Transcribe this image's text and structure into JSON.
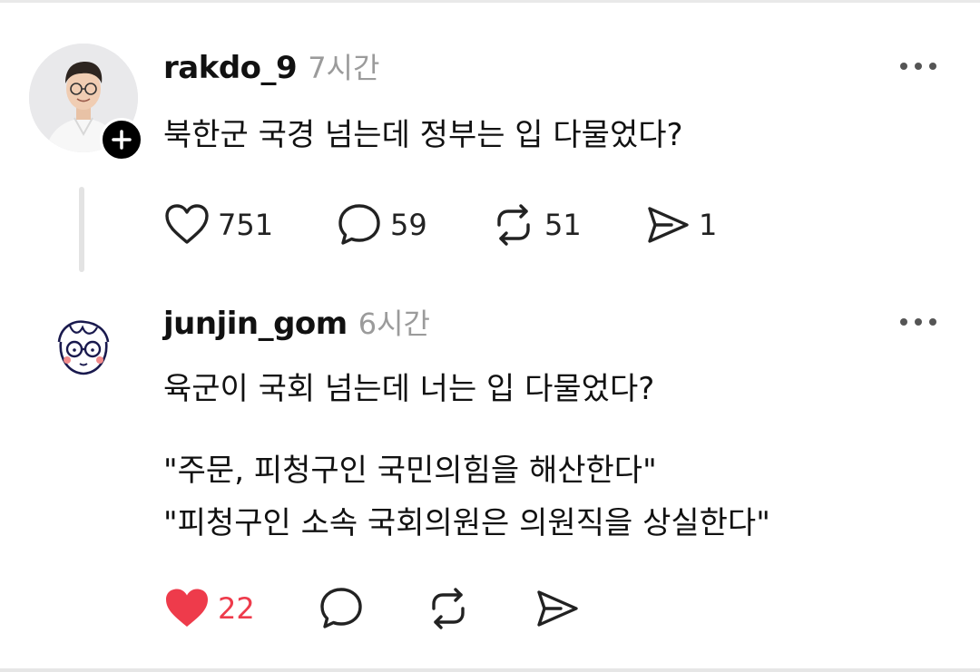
{
  "posts": [
    {
      "username": "rakdo_9",
      "timestamp": "7시간",
      "text": "북한군 국경 넘는데 정부는 입 다물었다?",
      "avatar": "profile-photo",
      "follow_icon": "plus-icon",
      "more_icon": "more-dots-icon",
      "actions": {
        "like_count": "751",
        "comment_count": "59",
        "repost_count": "51",
        "share_count": "1",
        "liked": false
      }
    },
    {
      "username": "junjin_gom",
      "timestamp": "6시간",
      "lines": [
        "육군이 국회 넘는데 너는 입 다물었다?",
        "\"주문, 피청구인 국민의힘을 해산한다\"",
        "\"피청구인 소속 국회의원은 의원직을 상실한다\""
      ],
      "avatar": "doodle-face-avatar",
      "more_icon": "more-dots-icon",
      "actions": {
        "like_count": "22",
        "liked": true
      }
    }
  ],
  "colors": {
    "liked": "#ee3b4b",
    "muted_text": "#9b9b9b",
    "primary_text": "#111111",
    "divider": "#e6e6e6"
  }
}
